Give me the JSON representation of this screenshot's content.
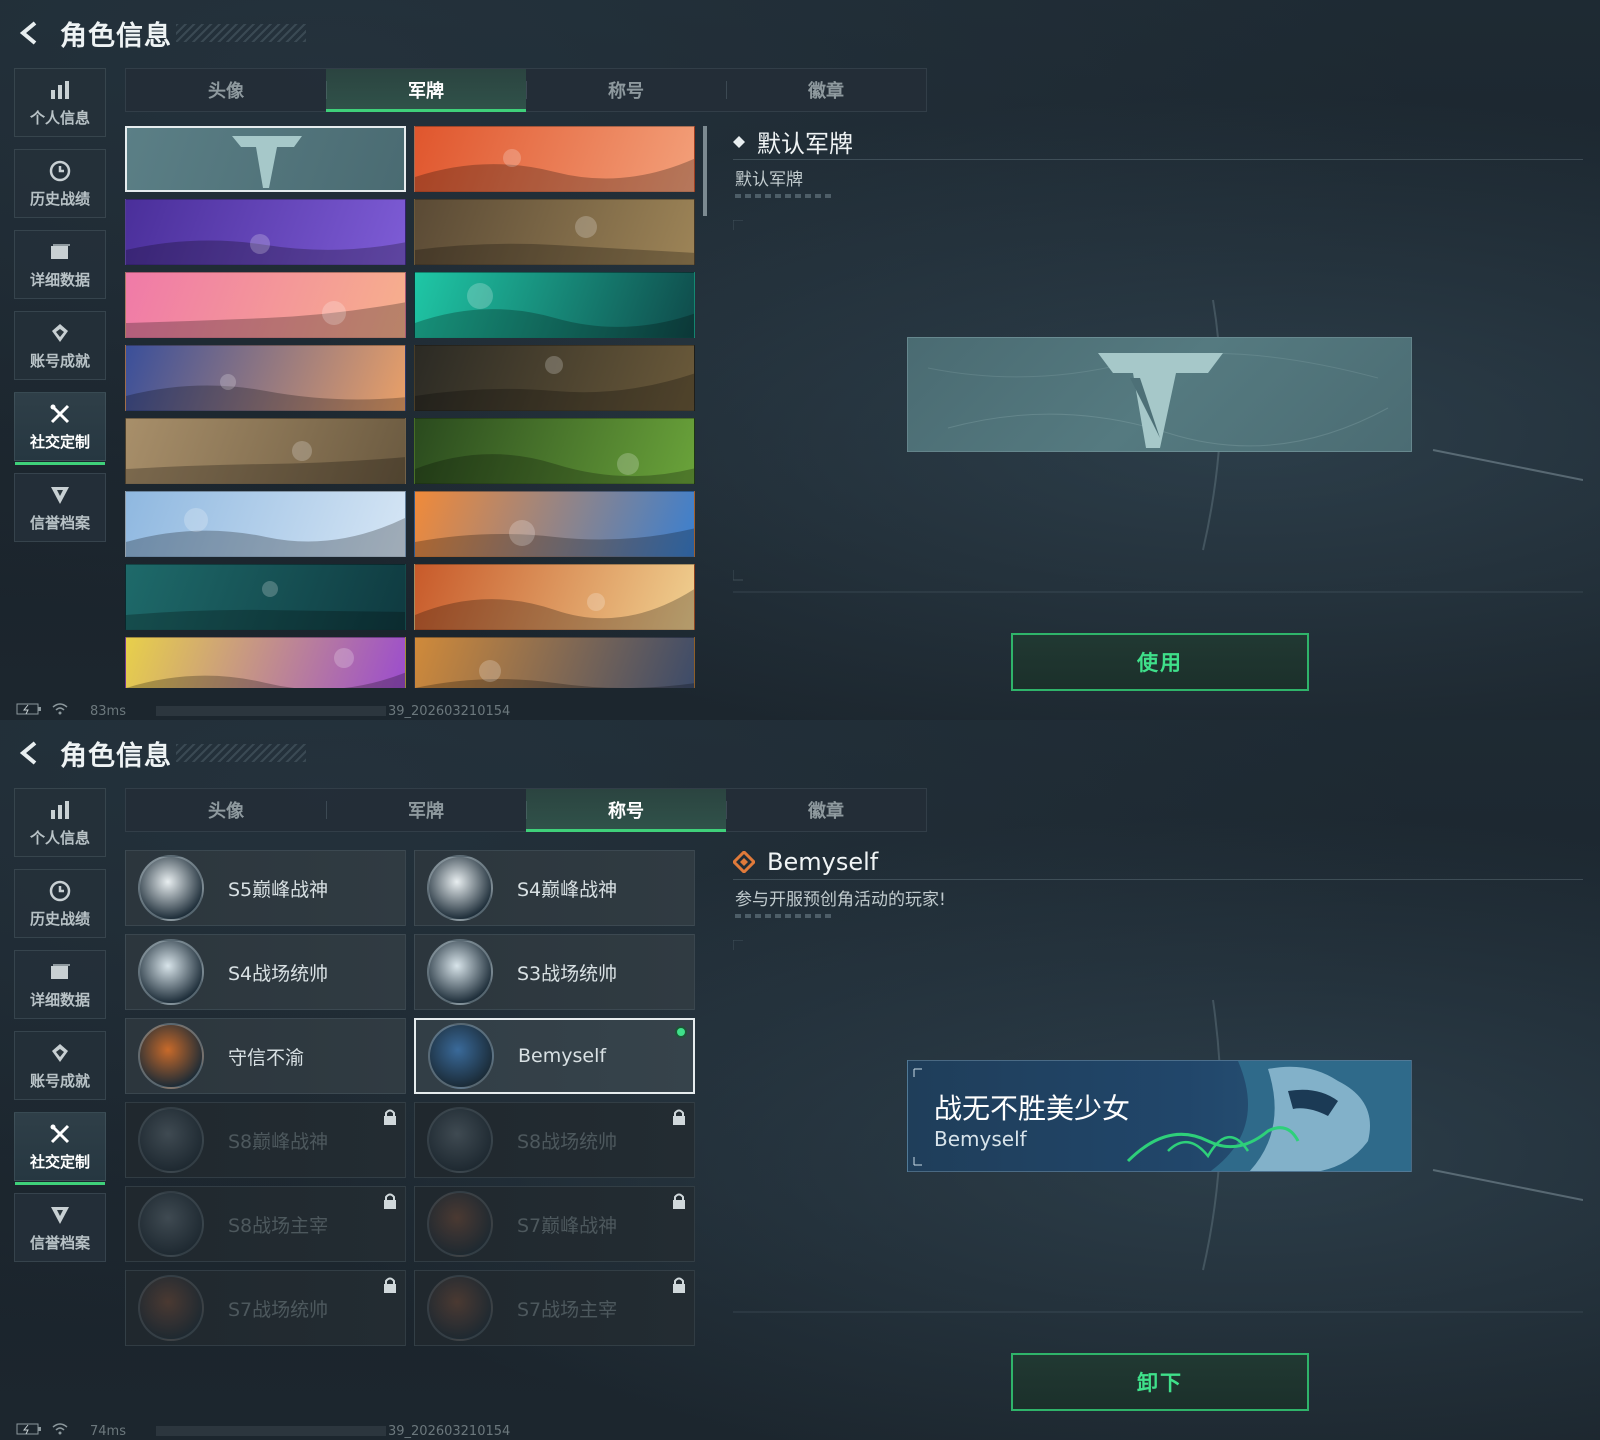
{
  "header": {
    "title": "角色信息"
  },
  "sidebar": {
    "items": [
      {
        "label": "个人信息",
        "icon": "bar-chart-icon"
      },
      {
        "label": "历史战绩",
        "icon": "clock-icon"
      },
      {
        "label": "详细数据",
        "icon": "folder-icon"
      },
      {
        "label": "账号成就",
        "icon": "achievement-icon"
      },
      {
        "label": "社交定制",
        "icon": "tools-icon",
        "active": true
      },
      {
        "label": "信誉档案",
        "icon": "shield-icon"
      }
    ]
  },
  "tabs": [
    "头像",
    "军牌",
    "称号",
    "徽章"
  ],
  "top_screen": {
    "active_tab": "军牌",
    "selected": {
      "title": "默认军牌",
      "description": "默认军牌"
    },
    "action_label": "使用",
    "status": {
      "ping": "83ms",
      "build": "39_202603210154"
    },
    "plates": [
      {
        "theme": "default-emblem",
        "colors": [
          "#5b7f86",
          "#4a6b72"
        ]
      },
      {
        "theme": "orange-drone",
        "colors": [
          "#e0562d",
          "#f3a07a"
        ]
      },
      {
        "theme": "purple-paws",
        "colors": [
          "#4a2f9a",
          "#7e5cd6"
        ]
      },
      {
        "theme": "desert-soldiers",
        "colors": [
          "#5a4a35",
          "#9d8457"
        ]
      },
      {
        "theme": "pink-cats",
        "colors": [
          "#f07aa8",
          "#f7b08c"
        ]
      },
      {
        "theme": "teal-comic",
        "colors": [
          "#1fc7a6",
          "#0f4a4a"
        ]
      },
      {
        "theme": "sky-paratroopers",
        "colors": [
          "#3a4f9a",
          "#e9a068"
        ]
      },
      {
        "theme": "weapons-table",
        "colors": [
          "#2b2a24",
          "#6b5a3a"
        ]
      },
      {
        "theme": "sniper-ruins",
        "colors": [
          "#a88f6a",
          "#6b5a40"
        ]
      },
      {
        "theme": "green-helicopter",
        "colors": [
          "#2a4a1e",
          "#6aa33a"
        ]
      },
      {
        "theme": "launch-sky",
        "colors": [
          "#8fb8e0",
          "#d6e6f5"
        ]
      },
      {
        "theme": "blue-orange-art",
        "colors": [
          "#f08a3a",
          "#3a7fd0"
        ]
      },
      {
        "theme": "teal-gym",
        "colors": [
          "#1e6a6a",
          "#0f3a40"
        ]
      },
      {
        "theme": "fire-soldier",
        "colors": [
          "#c85a2a",
          "#f0d090"
        ]
      },
      {
        "theme": "colorful-headphones",
        "colors": [
          "#e8d04a",
          "#9a4ad0"
        ]
      },
      {
        "theme": "desert-dunes",
        "colors": [
          "#d08a3a",
          "#3a4a6a"
        ]
      }
    ]
  },
  "bottom_screen": {
    "active_tab": "称号",
    "selected": {
      "title": "Bemyself",
      "description": "参与开服预创角活动的玩家!"
    },
    "preview": {
      "main": "战无不胜美少女",
      "sub": "Bemyself"
    },
    "action_label": "卸下",
    "status": {
      "ping": "74ms",
      "build": "39_202603210154"
    },
    "titles": [
      {
        "label": "S5巅峰战神",
        "emblem": "skull-emblem-icon",
        "locked": false,
        "color": "#e8eef0"
      },
      {
        "label": "S4巅峰战神",
        "emblem": "helmet-emblem-icon",
        "locked": false,
        "color": "#e8eef0"
      },
      {
        "label": "S4战场统帅",
        "emblem": "missile-emblem-icon",
        "locked": false,
        "color": "#d8e4ea"
      },
      {
        "label": "S3战场统帅",
        "emblem": "tank-emblem-icon",
        "locked": false,
        "color": "#d8e4ea"
      },
      {
        "label": "守信不渝",
        "emblem": "scales-emblem-icon",
        "locked": false,
        "color": "#c86a2a"
      },
      {
        "label": "Bemyself",
        "emblem": "soldier-emblem-icon",
        "locked": false,
        "selected": true,
        "color": "#3a6a9a"
      },
      {
        "label": "S8巅峰战神",
        "emblem": "slash-emblem-icon",
        "locked": true,
        "color": "#7a8a95"
      },
      {
        "label": "S8战场统帅",
        "emblem": "tank-emblem-icon",
        "locked": true,
        "color": "#7a8a95"
      },
      {
        "label": "S8战场主宰",
        "emblem": "building-emblem-icon",
        "locked": true,
        "color": "#7a8a95"
      },
      {
        "label": "S7巅峰战神",
        "emblem": "gun-emblem-icon",
        "locked": true,
        "color": "#9a5a3a"
      },
      {
        "label": "S7战场统帅",
        "emblem": "vehicle-emblem-icon",
        "locked": true,
        "color": "#9a5a3a"
      },
      {
        "label": "S7战场主宰",
        "emblem": "warrior-emblem-icon",
        "locked": true,
        "color": "#9a5a3a"
      }
    ]
  }
}
